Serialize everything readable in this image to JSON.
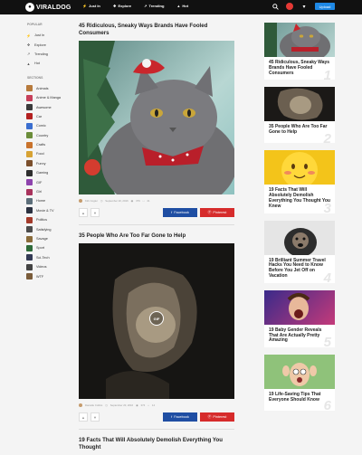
{
  "header": {
    "logo_text": "VIRALDOG",
    "nav": [
      {
        "label": "Just In",
        "icon": "lightning-icon"
      },
      {
        "label": "Explore",
        "icon": "compass-icon"
      },
      {
        "label": "Trending",
        "icon": "trending-icon"
      },
      {
        "label": "Hot",
        "icon": "flame-icon"
      }
    ],
    "upload_label": "Upload"
  },
  "sidebar": {
    "popular_heading": "POPULAR",
    "popular": [
      {
        "label": "Just In",
        "icon": "lightning-icon"
      },
      {
        "label": "Explore",
        "icon": "compass-icon"
      },
      {
        "label": "Trending",
        "icon": "trending-icon"
      },
      {
        "label": "Hot",
        "icon": "flame-icon"
      }
    ],
    "sections_heading": "SECTIONS",
    "sections": [
      {
        "label": "Animals",
        "color": "#b77a3c"
      },
      {
        "label": "Anime & Manga",
        "color": "#c7405a"
      },
      {
        "label": "Awesome",
        "color": "#3b3b3b"
      },
      {
        "label": "Car",
        "color": "#b32020"
      },
      {
        "label": "Comic",
        "color": "#3a6ecf"
      },
      {
        "label": "Country",
        "color": "#6b8d3a"
      },
      {
        "label": "Crafts",
        "color": "#c9732c"
      },
      {
        "label": "Food",
        "color": "#d7a233"
      },
      {
        "label": "Funny",
        "color": "#7b4f2c"
      },
      {
        "label": "Gaming",
        "color": "#2e2e2e"
      },
      {
        "label": "GIF",
        "color": "#8e44ad"
      },
      {
        "label": "Girl",
        "color": "#a8325c"
      },
      {
        "label": "Home",
        "color": "#5c6e7a"
      },
      {
        "label": "Movie & TV",
        "color": "#2b3140"
      },
      {
        "label": "Politics",
        "color": "#a33a2a"
      },
      {
        "label": "Satisfying",
        "color": "#4c4c4c"
      },
      {
        "label": "Savage",
        "color": "#8a6b3a"
      },
      {
        "label": "Sport",
        "color": "#2f6b3a"
      },
      {
        "label": "Sci-Tech",
        "color": "#333a55"
      },
      {
        "label": "Videos",
        "color": "#434343"
      },
      {
        "label": "WTF",
        "color": "#7a5c3a"
      }
    ]
  },
  "posts": [
    {
      "title": "45 Ridiculous, Sneaky Ways Brands Have Fooled Consumers",
      "author": "Kirk Cogler",
      "date": "September 20, 2016",
      "views": "376",
      "comments": "21",
      "facebook_label": "Facebook",
      "pinterest_label": "Pinterest"
    },
    {
      "title": "35 People Who Are Too Far Gone to Help",
      "author": "Danielle Collins",
      "date": "September 20, 2016",
      "views": "374",
      "comments": "14",
      "gif_label": "GIF",
      "facebook_label": "Facebook",
      "pinterest_label": "Pinterest"
    },
    {
      "title": "19 Facts That Will Absolutely Demolish Everything You Thought"
    }
  ],
  "trending": [
    {
      "title": "45 Ridiculous, Sneaky Ways Brands Have Fooled Consumers",
      "num": "1"
    },
    {
      "title": "35 People Who Are Too Far Gone to Help",
      "num": "2"
    },
    {
      "title": "19 Facts That Will Absolutely Demolish Everything You Thought You Knew",
      "num": "3"
    },
    {
      "title": "19 Brilliant Summer Travel Hacks You Need to Know Before You Jet Off on Vacation",
      "num": "4"
    },
    {
      "title": "19 Baby Gender Reveals That Are Actually Pretty Amazing",
      "num": "5"
    },
    {
      "title": "19 Life-Saving Tips That Everyone Should Know",
      "num": "6"
    }
  ]
}
